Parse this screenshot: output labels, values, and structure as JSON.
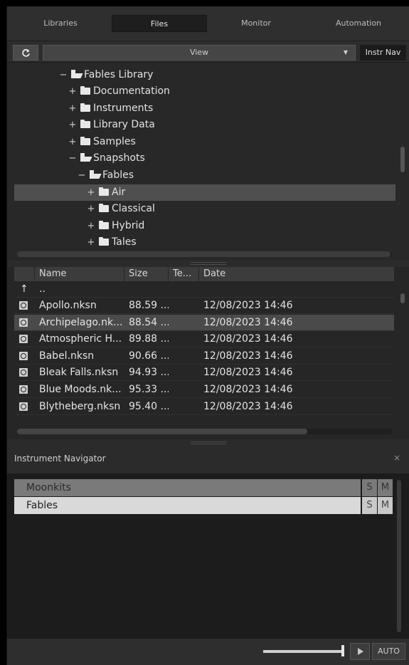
{
  "tabs": [
    {
      "label": "Libraries"
    },
    {
      "label": "Files"
    },
    {
      "label": "Monitor"
    },
    {
      "label": "Automation"
    }
  ],
  "toolbar": {
    "view_label": "View",
    "instr_nav_label": "Instr Nav"
  },
  "tree": {
    "items": [
      {
        "sign": "−",
        "label": "Fables Library",
        "open": true
      },
      {
        "sign": "+",
        "label": "Documentation",
        "open": false
      },
      {
        "sign": "+",
        "label": "Instruments",
        "open": false
      },
      {
        "sign": "+",
        "label": "Library Data",
        "open": false
      },
      {
        "sign": "+",
        "label": "Samples",
        "open": false
      },
      {
        "sign": "−",
        "label": "Snapshots",
        "open": true
      },
      {
        "sign": "−",
        "label": "Fables",
        "open": true
      },
      {
        "sign": "+",
        "label": "Air",
        "open": false,
        "selected": true
      },
      {
        "sign": "+",
        "label": "Classical",
        "open": false
      },
      {
        "sign": "+",
        "label": "Hybrid",
        "open": false
      },
      {
        "sign": "+",
        "label": "Tales",
        "open": false
      }
    ]
  },
  "files": {
    "columns": [
      "Name",
      "Size",
      "Te...",
      "Date"
    ],
    "up_arrow": "↑",
    "up_label": "..",
    "rows": [
      {
        "name": "Apollo.nksn",
        "size": "88.59 ...",
        "date": "12/08/2023 14:46"
      },
      {
        "name": "Archipelago.nk...",
        "size": "88.54 ...",
        "date": "12/08/2023 14:46",
        "selected": true
      },
      {
        "name": "Atmospheric H...",
        "size": "89.88 ...",
        "date": "12/08/2023 14:46"
      },
      {
        "name": "Babel.nksn",
        "size": "90.66 ...",
        "date": "12/08/2023 14:46"
      },
      {
        "name": "Bleak Falls.nksn",
        "size": "94.93 ...",
        "date": "12/08/2023 14:46"
      },
      {
        "name": "Blue Moods.nk...",
        "size": "95.33 ...",
        "date": "12/08/2023 14:46"
      },
      {
        "name": "Blytheberg.nksn",
        "size": "95.40 ...",
        "date": "12/08/2023 14:46"
      }
    ]
  },
  "navigator": {
    "title": "Instrument Navigator",
    "close": "×",
    "items": [
      {
        "label": "Moonkits",
        "s": "S",
        "m": "M"
      },
      {
        "label": "Fables",
        "s": "S",
        "m": "M"
      }
    ]
  },
  "bottom": {
    "auto_label": "AUTO"
  },
  "colors": {
    "background": "#2e2e2e",
    "selected_row": "#4f4f4f",
    "nav_item_inactive": "#7a7a7a",
    "nav_item_active": "#d9d9d9"
  }
}
